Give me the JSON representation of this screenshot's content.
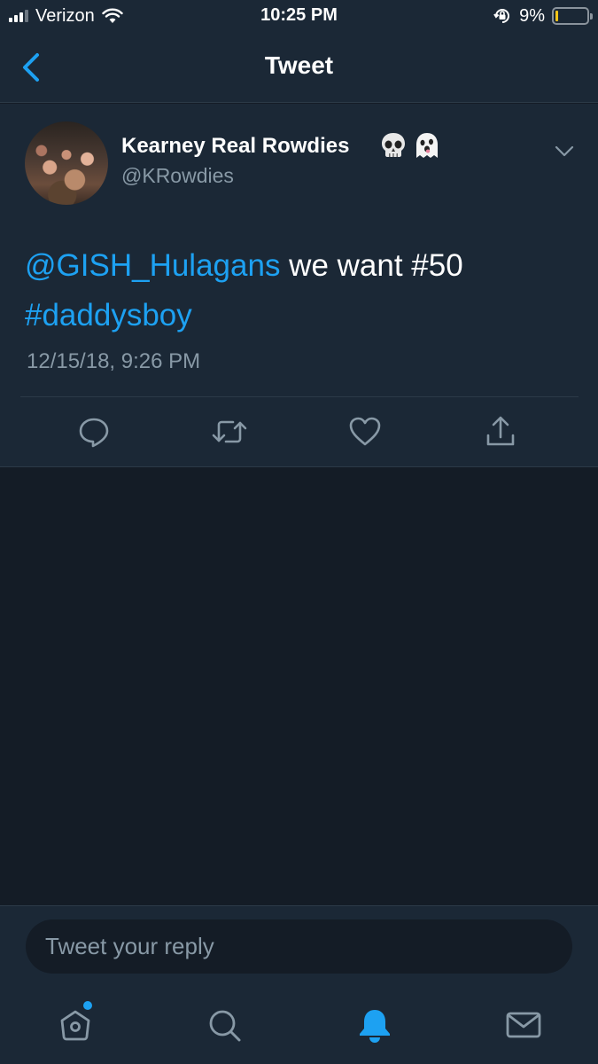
{
  "status_bar": {
    "carrier": "Verizon",
    "time": "10:25 PM",
    "battery_percent": "9%",
    "battery_level": 0.09,
    "icons": [
      "signal-icon",
      "wifi-icon",
      "rotation-lock-icon",
      "battery-icon"
    ]
  },
  "nav": {
    "title": "Tweet",
    "back_icon": "chevron-left-icon"
  },
  "tweet": {
    "display_name": "Kearney Real Rowdies",
    "name_emojis": [
      "skull-emoji",
      "ghost-emoji"
    ],
    "handle": "@KRowdies",
    "mention": "@GISH_Hulagans",
    "text": " we want #50",
    "hashtag": "#daddysboy",
    "timestamp": "12/15/18, 9:26 PM",
    "actions": [
      "reply-icon",
      "retweet-icon",
      "like-icon",
      "share-icon"
    ]
  },
  "reply": {
    "placeholder": "Tweet your reply"
  },
  "tab_bar": {
    "tabs": [
      "home-icon",
      "search-icon",
      "notifications-icon",
      "messages-icon"
    ],
    "active": "notifications",
    "home_has_new": true
  },
  "colors": {
    "background": "#141c26",
    "surface": "#1b2836",
    "accent": "#1da1f2",
    "secondary_text": "#8899a6"
  }
}
